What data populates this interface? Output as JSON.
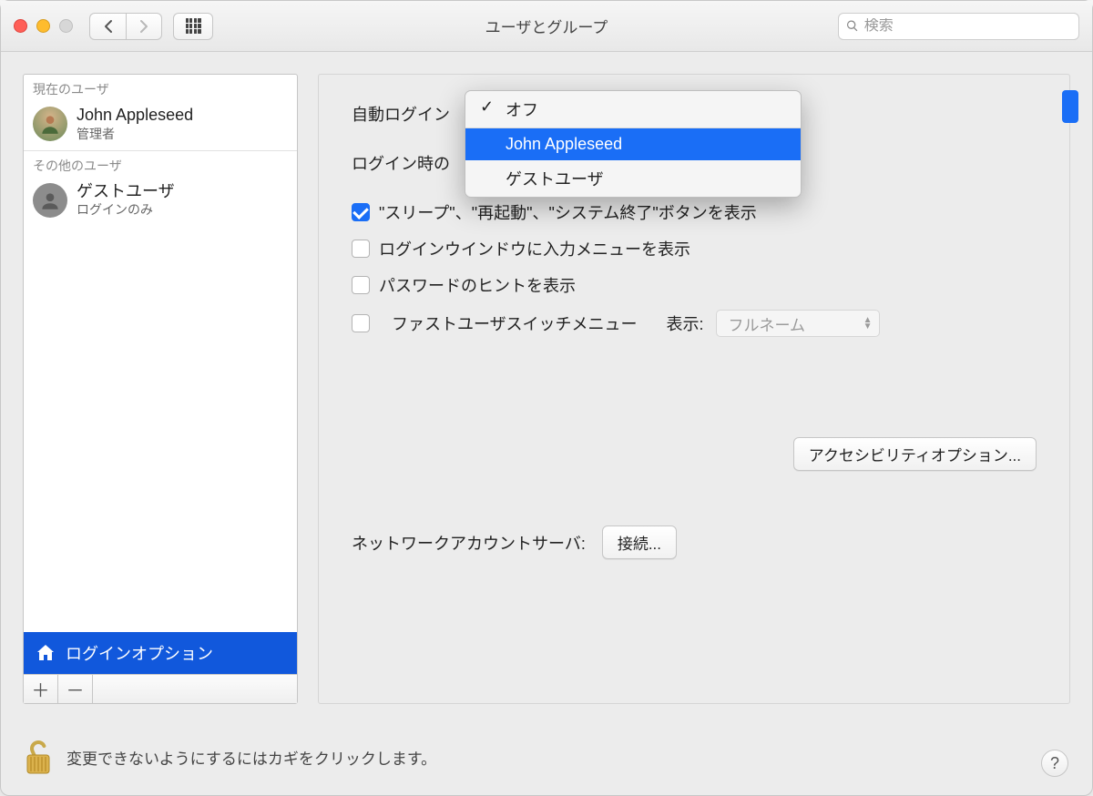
{
  "window": {
    "title": "ユーザとグループ"
  },
  "search": {
    "placeholder": "検索"
  },
  "sidebar": {
    "current_label": "現在のユーザ",
    "others_label": "その他のユーザ",
    "current_user": {
      "name": "John Appleseed",
      "role": "管理者"
    },
    "other_user": {
      "name": "ゲストユーザ",
      "role": "ログインのみ"
    },
    "login_options": "ログインオプション"
  },
  "panel": {
    "auto_login_label": "自動ログイン",
    "login_time_label": "ログイン時の",
    "checkboxes": {
      "sleep_restart": "\"スリープ\"、\"再起動\"、\"システム終了\"ボタンを表示",
      "input_menu": "ログインウインドウに入力メニューを表示",
      "pw_hint": "パスワードのヒントを表示",
      "fast_switch": "ファストユーザスイッチメニュー"
    },
    "fast_switch_show_label": "表示:",
    "fast_switch_menu_value": "フルネーム",
    "accessibility_button": "アクセシビリティオプション...",
    "network_label": "ネットワークアカウントサーバ:",
    "connect_button": "接続..."
  },
  "dropdown": {
    "off": "オフ",
    "items": [
      "John Appleseed",
      "ゲストユーザ"
    ],
    "highlighted_index": 0
  },
  "footer": {
    "lock_text": "変更できないようにするにはカギをクリックします。"
  }
}
